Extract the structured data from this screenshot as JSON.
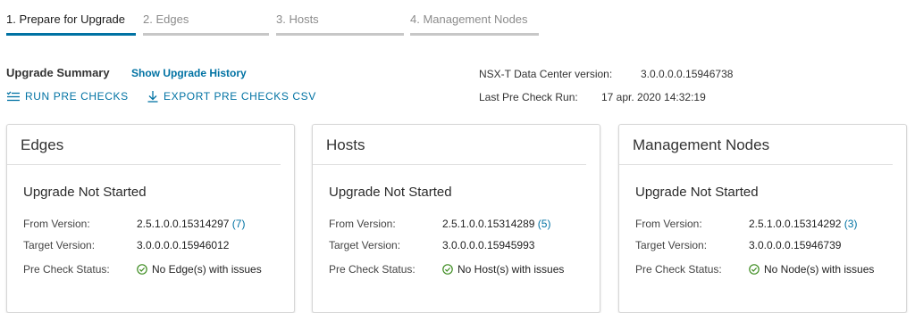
{
  "steps": [
    {
      "label": "1. Prepare for Upgrade",
      "state": "active"
    },
    {
      "label": "2. Edges",
      "state": "inactive"
    },
    {
      "label": "3. Hosts",
      "state": "inactive"
    },
    {
      "label": "4. Management Nodes",
      "state": "inactive"
    }
  ],
  "summary": {
    "title": "Upgrade Summary",
    "history_link": "Show Upgrade History",
    "run_pre_checks": "RUN PRE CHECKS",
    "export_csv": "EXPORT PRE CHECKS CSV",
    "version_label": "NSX-T Data Center version:",
    "version_value": "3.0.0.0.0.15946738",
    "last_run_label": "Last Pre Check Run:",
    "last_run_value": "17 apr. 2020 14:32:19"
  },
  "labels": {
    "from": "From Version:",
    "target": "Target Version:",
    "precheck": "Pre Check Status:"
  },
  "cards": [
    {
      "title": "Edges",
      "status": "Upgrade Not Started",
      "from_version": "2.5.1.0.0.15314297",
      "from_count": "(7)",
      "target_version": "3.0.0.0.0.15946012",
      "precheck": "No Edge(s) with issues"
    },
    {
      "title": "Hosts",
      "status": "Upgrade Not Started",
      "from_version": "2.5.1.0.0.15314289",
      "from_count": "(5)",
      "target_version": "3.0.0.0.0.15945993",
      "precheck": "No Host(s) with issues"
    },
    {
      "title": "Management Nodes",
      "status": "Upgrade Not Started",
      "from_version": "2.5.1.0.0.15314292",
      "from_count": "(3)",
      "target_version": "3.0.0.0.0.15946739",
      "precheck": "No Node(s) with issues"
    }
  ],
  "colors": {
    "accent": "#0072a3",
    "success": "#3c8b1f"
  },
  "icons": {
    "run": "list-check-icon",
    "export": "download-icon",
    "precheck": "success-circle-icon"
  }
}
